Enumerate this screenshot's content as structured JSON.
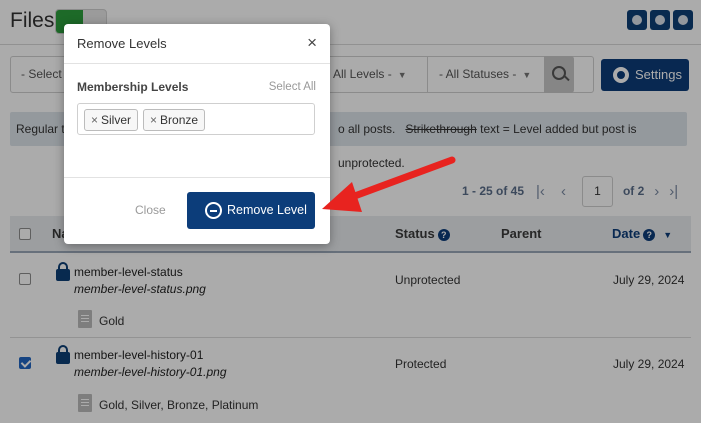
{
  "page": {
    "title": "Files",
    "filters": {
      "select": "- Select a",
      "levels": "All Levels -",
      "statuses": "- All Statuses -"
    },
    "settings_label": "Settings",
    "legend": {
      "left": "Regular t",
      "right_pre": "o all posts.",
      "strike_word": "Strikethrough",
      "right_post": "text = Level added but post is unprotected."
    },
    "pager": {
      "range": "1 - 25 of 45",
      "page_value": "1",
      "of_pages": "of 2"
    },
    "table": {
      "col_name": "Na",
      "col_status": "Status",
      "col_parent": "Parent",
      "col_date": "Date",
      "help": "?",
      "rows": [
        {
          "name": "member-level-status",
          "file": "member-level-status.png",
          "levels": "Gold",
          "status": "Unprotected",
          "date": "July 29, 2024",
          "checked": false
        },
        {
          "name": "member-level-history-01",
          "file": "member-level-history-01.png",
          "levels": "Gold, Silver, Bronze, Platinum",
          "status": "Protected",
          "date": "July 29, 2024",
          "checked": true
        }
      ]
    }
  },
  "modal": {
    "title": "Remove Levels",
    "close_glyph": "×",
    "section_label": "Membership Levels",
    "select_all": "Select All",
    "tag_remove_glyph": "×",
    "tags": [
      "Silver",
      "Bronze"
    ],
    "close_button": "Close",
    "remove_button": "Remove Level"
  },
  "colors": {
    "primary": "#0c3d7a",
    "annotation_arrow": "#e8231f"
  }
}
